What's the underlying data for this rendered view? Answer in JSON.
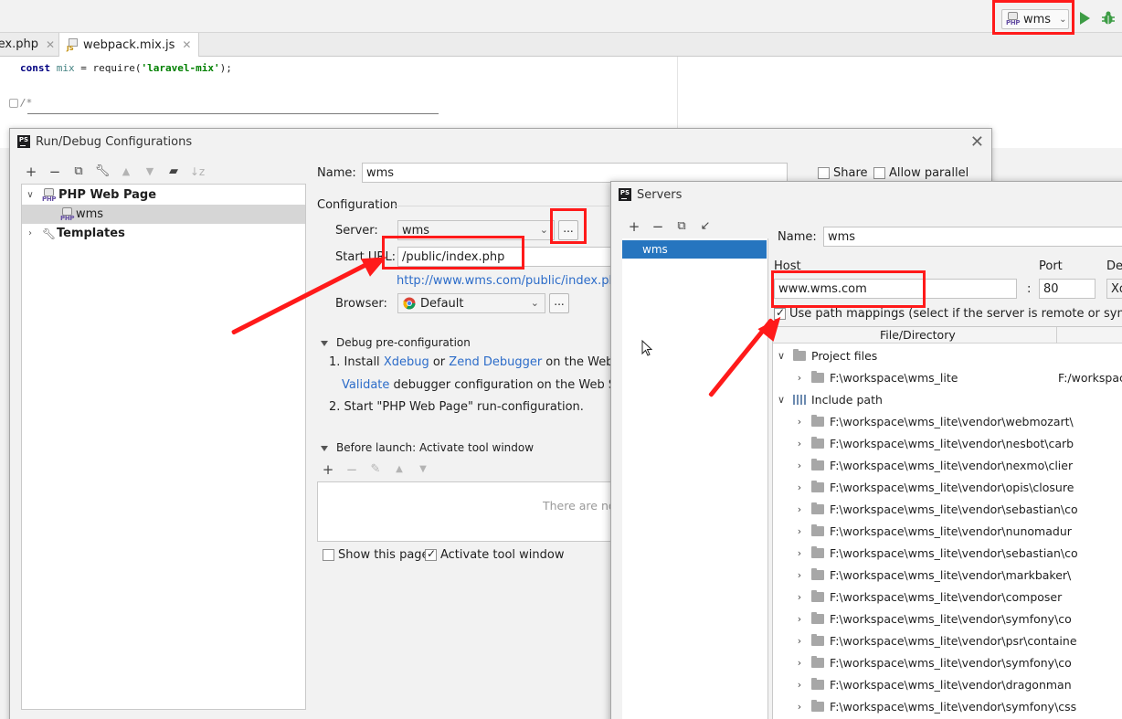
{
  "toolbar": {
    "run_config": "wms"
  },
  "tabs": [
    {
      "label": "lex.php"
    },
    {
      "label": "webpack.mix.js"
    }
  ],
  "editor": {
    "line1_kw": "const",
    "line1_var": "mix",
    "line1_eq": " = ",
    "line1_call": "require(",
    "line1_str": "'laravel-mix'",
    "line1_end": ");",
    "line2": "/*"
  },
  "run_dialog": {
    "title": "Run/Debug Configurations",
    "tree": {
      "group": "PHP Web Page",
      "item": "wms",
      "templates": "Templates"
    },
    "name_label": "Name:",
    "name_value": "wms",
    "share_label": "Share",
    "parallel_label": "Allow parallel run",
    "configuration_label": "Configuration",
    "server_label": "Server:",
    "server_value": "wms",
    "server_btn": "...",
    "start_url_label": "Start URL:",
    "start_url_value": "/public/index.php",
    "resolved_url": "http://www.wms.com/public/index.php",
    "browser_label": "Browser:",
    "browser_value": "Default",
    "browser_btn": "...",
    "debug_pre_label": "Debug pre-configuration",
    "step1_prefix": "1. Install ",
    "step1_xdebug": "Xdebug",
    "step1_or": " or ",
    "step1_zend": "Zend Debugger",
    "step1_suffix": " on the Web Ser",
    "validate_link": "Validate",
    "validate_suffix": " debugger configuration on the Web Serve",
    "step2": "2. Start \"PHP Web Page\" run-configuration.",
    "before_launch_label": "Before launch: Activate tool window",
    "empty_text": "There are no",
    "show_page_label": "Show this page",
    "activate_tool_label": "Activate tool window"
  },
  "servers_dialog": {
    "title": "Servers",
    "list": [
      "wms"
    ],
    "name_label": "Name:",
    "name_value": "wms",
    "host_label": "Host",
    "host_value": "www.wms.com",
    "port_label": "Port",
    "port_value": "80",
    "colon": ":",
    "debugger_label": "Del",
    "debugger_value": "Xd",
    "use_path_mappings": "Use path mappings (select if the server is remote or symlinks a",
    "table_header": "File/Directory",
    "project_files": "Project files",
    "project_path": "F:\\workspace\\wms_lite",
    "project_remote": "F:/workspac",
    "include_path": "Include path",
    "include_rows": [
      "F:\\workspace\\wms_lite\\vendor\\webmozart\\",
      "F:\\workspace\\wms_lite\\vendor\\nesbot\\carb",
      "F:\\workspace\\wms_lite\\vendor\\nexmo\\clier",
      "F:\\workspace\\wms_lite\\vendor\\opis\\closure",
      "F:\\workspace\\wms_lite\\vendor\\sebastian\\co",
      "F:\\workspace\\wms_lite\\vendor\\nunomadur",
      "F:\\workspace\\wms_lite\\vendor\\sebastian\\co",
      "F:\\workspace\\wms_lite\\vendor\\markbaker\\",
      "F:\\workspace\\wms_lite\\vendor\\composer",
      "F:\\workspace\\wms_lite\\vendor\\symfony\\co",
      "F:\\workspace\\wms_lite\\vendor\\psr\\containe",
      "F:\\workspace\\wms_lite\\vendor\\symfony\\co",
      "F:\\workspace\\wms_lite\\vendor\\dragonman",
      "F:\\workspace\\wms_lite\\vendor\\symfony\\css"
    ]
  },
  "colors": {
    "annotation": "#ff1a1a",
    "selection": "#2675bf",
    "link": "#2c6cc9"
  }
}
